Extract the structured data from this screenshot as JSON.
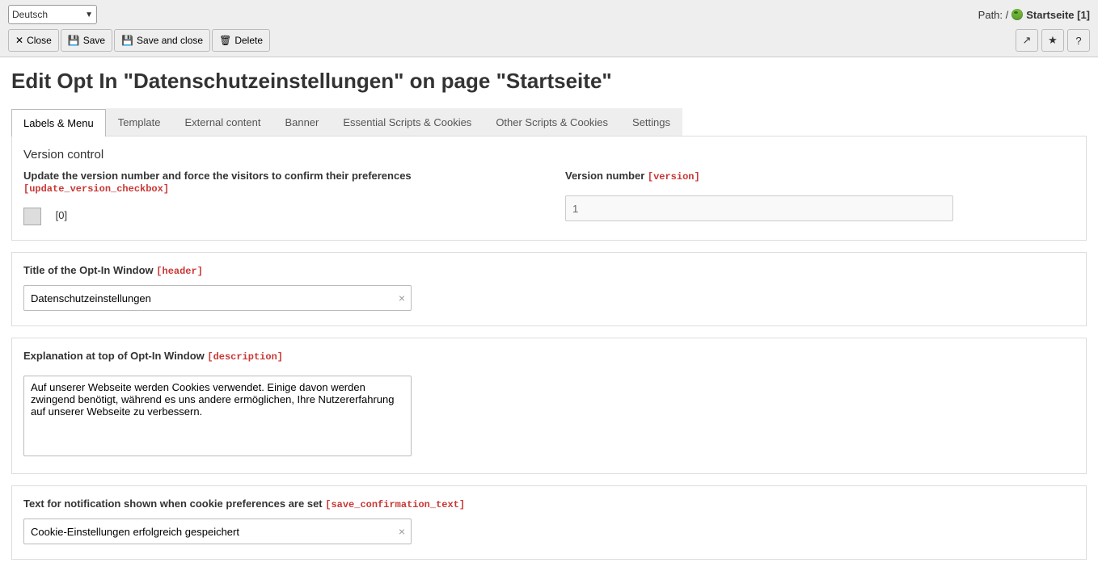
{
  "topbar": {
    "language": "Deutsch",
    "path_prefix": "Path: /",
    "breadcrumb": "Startseite [1]"
  },
  "toolbar": {
    "close": "Close",
    "save": "Save",
    "save_close": "Save and close",
    "delete": "Delete"
  },
  "heading": "Edit Opt In \"Datenschutzeinstellungen\" on page \"Startseite\"",
  "tabs": [
    "Labels & Menu",
    "Template",
    "External content",
    "Banner",
    "Essential Scripts & Cookies",
    "Other Scripts & Cookies",
    "Settings"
  ],
  "version": {
    "section_title": "Version control",
    "update_label": "Update the version number and force the visitors to confirm their preferences",
    "update_tech": "[update_version_checkbox]",
    "checkbox_hint": "[0]",
    "number_label": "Version number",
    "number_tech": "[version]",
    "number_value": "1"
  },
  "title_field": {
    "label": "Title of the Opt-In Window",
    "tech": "[header]",
    "value": "Datenschutzeinstellungen"
  },
  "description_field": {
    "label": "Explanation at top of Opt-In Window",
    "tech": "[description]",
    "value": "Auf unserer Webseite werden Cookies verwendet. Einige davon werden zwingend benötigt, während es uns andere ermöglichen, Ihre Nutzererfahrung auf unserer Webseite zu verbessern."
  },
  "save_conf": {
    "label": "Text for notification shown when cookie preferences are set",
    "tech": "[save_confirmation_text]",
    "value": "Cookie-Einstellungen erfolgreich gespeichert"
  }
}
